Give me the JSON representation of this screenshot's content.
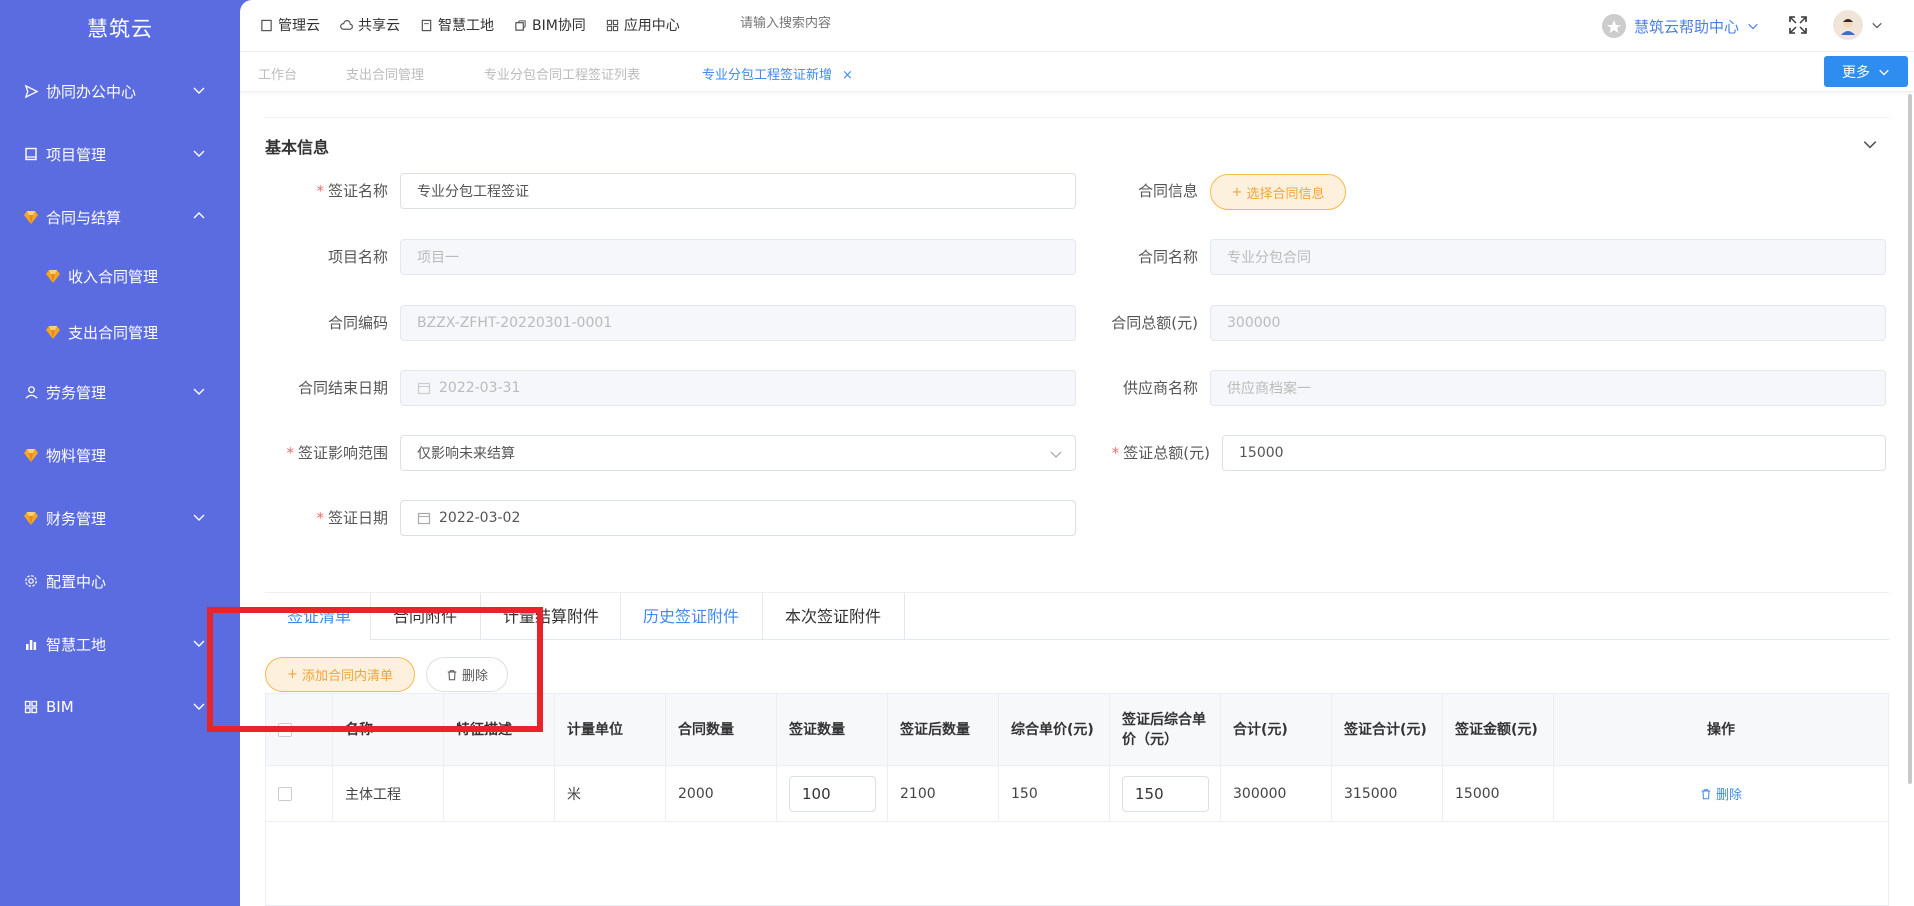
{
  "app": {
    "brand": "慧筑云"
  },
  "sidebar": {
    "items": [
      {
        "label": "协同办公中心",
        "icon": "send-icon",
        "expandable": true,
        "expanded": false
      },
      {
        "label": "项目管理",
        "icon": "book-icon",
        "expandable": true,
        "expanded": false
      },
      {
        "label": "合同与结算",
        "icon": "gem-icon",
        "expandable": true,
        "expanded": true
      },
      {
        "label": "收入合同管理",
        "icon": "gem-icon",
        "sub": true
      },
      {
        "label": "支出合同管理",
        "icon": "gem-icon",
        "sub": true
      },
      {
        "label": "劳务管理",
        "icon": "user-icon",
        "expandable": true,
        "expanded": false
      },
      {
        "label": "物料管理",
        "icon": "gem-icon",
        "expandable": false
      },
      {
        "label": "财务管理",
        "icon": "gem-icon",
        "expandable": true,
        "expanded": false
      },
      {
        "label": "配置中心",
        "icon": "gear-icon",
        "expandable": false
      },
      {
        "label": "智慧工地",
        "icon": "bar-chart-icon",
        "expandable": true,
        "expanded": false
      },
      {
        "label": "BIM",
        "icon": "grid-icon",
        "expandable": true,
        "expanded": false
      }
    ]
  },
  "topnav": {
    "items": [
      "管理云",
      "共享云",
      "智慧工地",
      "BIM协同",
      "应用中心"
    ],
    "search_placeholder": "请输入搜索内容",
    "help_label": "慧筑云帮助中心"
  },
  "tabs": {
    "items": [
      "工作台",
      "支出合同管理",
      "专业分包合同工程签证列表",
      "专业分包工程签证新增"
    ],
    "active_index": 3,
    "close_glyph": "×",
    "more_label": "更多"
  },
  "form": {
    "section_title": "基本信息",
    "visa_name": {
      "label": "签证名称",
      "value": "专业分包工程签证",
      "required": true
    },
    "contract_info": {
      "label": "合同信息",
      "button": "选择合同信息"
    },
    "project_name": {
      "label": "项目名称",
      "value": "项目一"
    },
    "contract_name": {
      "label": "合同名称",
      "value": "专业分包合同"
    },
    "contract_code": {
      "label": "合同编码",
      "value": "BZZX-ZFHT-20220301-0001"
    },
    "contract_total": {
      "label": "合同总额(元)",
      "value": "300000"
    },
    "contract_end": {
      "label": "合同结束日期",
      "value": "2022-03-31"
    },
    "supplier": {
      "label": "供应商名称",
      "value": "供应商档案一"
    },
    "visa_scope": {
      "label": "签证影响范围",
      "value": "仅影响未来结算",
      "required": true
    },
    "visa_total": {
      "label": "签证总额(元)",
      "value": "15000",
      "required": true
    },
    "visa_date": {
      "label": "签证日期",
      "value": "2022-03-02",
      "required": true
    }
  },
  "detail_tabs": {
    "items": [
      "签证清单",
      "合同附件",
      "计量结算附件",
      "历史签证附件",
      "本次签证附件"
    ],
    "active_index": 0
  },
  "actions": {
    "add_label": "添加合同内清单",
    "delete_label": "删除"
  },
  "table": {
    "headers": [
      "名称",
      "特征描述",
      "计量单位",
      "合同数量",
      "签证数量",
      "签证后数量",
      "综合单价(元)",
      "签证后综合单价（元）",
      "合计(元)",
      "签证合计(元)",
      "签证金额(元)",
      "操作"
    ],
    "rows": [
      {
        "name": "主体工程",
        "feature": "",
        "unit": "米",
        "contract_qty": "2000",
        "visa_qty": "100",
        "after_qty": "2100",
        "unit_price": "150",
        "after_unit_price": "150",
        "total": "300000",
        "visa_total": "315000",
        "visa_amount": "15000",
        "op": "删除"
      }
    ]
  },
  "colors": {
    "sidebar_bg": "#5b6ce0",
    "primary": "#3d8bf0",
    "warning": "#f0a43a",
    "required": "#f56c6c",
    "highlight": "#e8232a"
  }
}
